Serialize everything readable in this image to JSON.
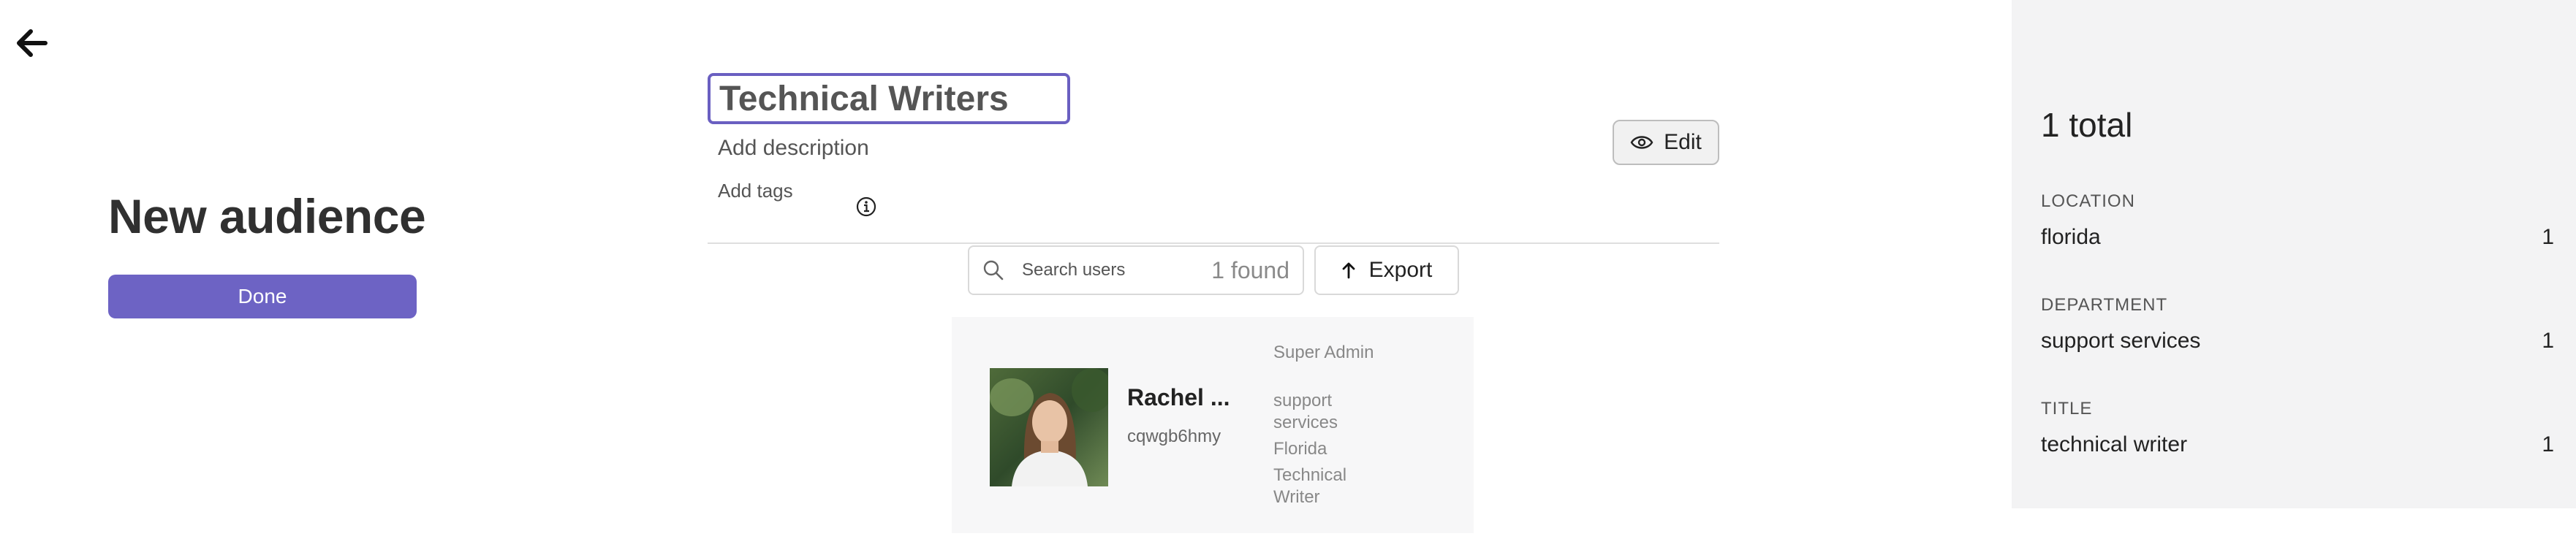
{
  "page": {
    "title": "New audience",
    "done_label": "Done"
  },
  "audience": {
    "name": "Technical Writers",
    "description_placeholder": "Add description",
    "tags_placeholder": "Add tags"
  },
  "toolbar": {
    "edit_label": "Edit",
    "export_label": "Export"
  },
  "search": {
    "placeholder": "Search users",
    "found_text": "1 found"
  },
  "users": [
    {
      "name": "Rachel ...",
      "id": "cqwgb6hmy",
      "attributes": [
        "Super Admin",
        "support services",
        "Florida",
        "Technical Writer"
      ]
    }
  ],
  "summary": {
    "total": "1 total",
    "sections": [
      {
        "label": "LOCATION",
        "value": "florida",
        "count": "1"
      },
      {
        "label": "DEPARTMENT",
        "value": "support services",
        "count": "1"
      },
      {
        "label": "TITLE",
        "value": "technical writer",
        "count": "1"
      }
    ]
  },
  "colors": {
    "accent": "#6d63c4",
    "focus_border": "#6a5fc1",
    "panel_bg": "#f3f3f4",
    "card_bg": "#f7f7f8"
  }
}
